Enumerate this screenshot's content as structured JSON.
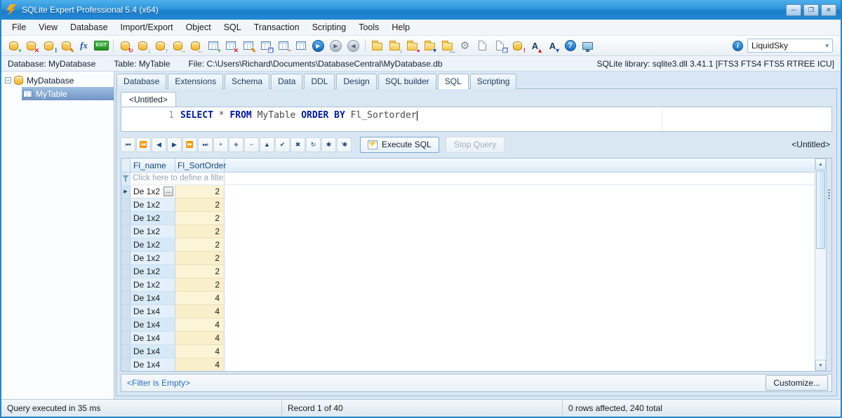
{
  "window": {
    "title": "SQLite Expert Professional 5.4 (x64)",
    "minimize_glyph": "─",
    "maximize_glyph": "❐",
    "close_glyph": "✕"
  },
  "menu": {
    "items": [
      "File",
      "View",
      "Database",
      "Import/Export",
      "Object",
      "SQL",
      "Transaction",
      "Scripting",
      "Tools",
      "Help"
    ]
  },
  "toolbar": {
    "icons": [
      {
        "name": "new-database-icon",
        "type": "db",
        "badge": "+",
        "badge_color": "#1f9d1f"
      },
      {
        "name": "close-database-icon",
        "type": "db",
        "badge": "✕",
        "badge_color": "#cc2222"
      },
      {
        "name": "rename-database-icon",
        "type": "db",
        "badge": "I",
        "badge_color": "#2255cc"
      },
      {
        "name": "edit-database-icon",
        "type": "db",
        "badge": "✎",
        "badge_color": "#d07a00"
      },
      {
        "name": "function-editor-icon",
        "type": "fx",
        "glyph": "fx"
      },
      {
        "name": "exit-icon",
        "type": "exit",
        "glyph": "EXIT"
      },
      {
        "type": "sep"
      },
      {
        "name": "reload-database-icon",
        "type": "db",
        "badge": "↻",
        "badge_color": "#cc2222"
      },
      {
        "name": "import-database-icon",
        "type": "db",
        "badge": "↓",
        "badge_color": "#1f9d1f"
      },
      {
        "name": "export-database-icon",
        "type": "db",
        "badge": "↑",
        "badge_color": "#2255cc"
      },
      {
        "name": "attach-database-icon",
        "type": "db",
        "badge": "→",
        "badge_color": "#1f9d1f"
      },
      {
        "name": "detach-database-icon",
        "type": "db",
        "badge": "←",
        "badge_color": "#cc2222"
      },
      {
        "name": "new-table-icon",
        "type": "table",
        "badge": "+",
        "badge_color": "#1f9d1f"
      },
      {
        "name": "drop-table-icon",
        "type": "table",
        "badge": "✕",
        "badge_color": "#cc2222"
      },
      {
        "name": "design-table-icon",
        "type": "table",
        "badge": "✎",
        "badge_color": "#d07a00"
      },
      {
        "name": "duplicate-table-icon",
        "type": "table",
        "badge": "❐",
        "badge_color": "#2255cc"
      },
      {
        "name": "empty-table-icon",
        "type": "table",
        "badge": "−",
        "badge_color": "#cc2222"
      },
      {
        "name": "view-data-icon",
        "type": "table"
      },
      {
        "name": "run-script-icon",
        "type": "circle-blue",
        "glyph": "▶"
      },
      {
        "name": "step-forward-icon",
        "type": "circle-gray",
        "glyph": "▶"
      },
      {
        "name": "step-back-icon",
        "type": "circle-gray",
        "glyph": "◀"
      },
      {
        "type": "sep"
      },
      {
        "name": "new-script-folder-icon",
        "type": "folder"
      },
      {
        "name": "open-script-icon",
        "type": "folder",
        "badge": "↓",
        "badge_color": "#2255cc"
      },
      {
        "name": "favorite-scripts-icon",
        "type": "folder",
        "badge": "●",
        "badge_color": "#d03a8a"
      },
      {
        "name": "save-script-icon",
        "type": "folder",
        "badge": "▼",
        "badge_color": "#2255cc"
      },
      {
        "name": "browse-scripts-icon",
        "type": "folder",
        "badge": "…",
        "badge_color": "#555555"
      },
      {
        "name": "options-gear-icon",
        "type": "gear",
        "glyph": "⚙"
      },
      {
        "name": "new-document-icon",
        "type": "doc"
      },
      {
        "name": "copy-document-icon",
        "type": "doc",
        "badge": "❐",
        "badge_color": "#2255cc"
      },
      {
        "name": "database-tools-icon",
        "type": "db",
        "badge": "!",
        "badge_color": "#cc2222"
      },
      {
        "name": "increase-font-icon",
        "type": "fontA",
        "glyph": "A",
        "badge": "▲",
        "badge_color": "#cc2222"
      },
      {
        "name": "decrease-font-icon",
        "type": "fontA",
        "glyph": "A",
        "badge": "▼",
        "badge_color": "#2255cc"
      },
      {
        "name": "help-icon",
        "type": "help",
        "glyph": "?"
      },
      {
        "name": "sql-monitor-icon",
        "type": "monitor"
      }
    ],
    "info_glyph": "i",
    "theme": {
      "selected": "LiquidSky",
      "dropdown_glyph": "▾"
    }
  },
  "info_bar": {
    "database": "Database: MyDatabase",
    "table": "Table: MyTable",
    "file": "File: C:\\Users\\Richard\\Documents\\DatabaseCentral\\MyDatabase.db",
    "library": "SQLite library: sqlite3.dll 3.41.1 [FTS3 FTS4 FTS5 RTREE ICU]"
  },
  "tree": {
    "expander_glyph": "−",
    "root": "MyDatabase",
    "child": "MyTable"
  },
  "tabs": {
    "items": [
      "Database",
      "Extensions",
      "Schema",
      "Data",
      "DDL",
      "Design",
      "SQL builder",
      "SQL",
      "Scripting"
    ],
    "active": "SQL"
  },
  "editor": {
    "tab": "<Untitled>",
    "line_number": "1",
    "tokens": [
      {
        "t": "SELECT ",
        "k": true
      },
      {
        "t": "* ",
        "k": false
      },
      {
        "t": "FROM ",
        "k": true
      },
      {
        "t": "MyTable ",
        "k": false
      },
      {
        "t": "ORDER BY ",
        "k": true
      },
      {
        "t": "Fl_Sortorder",
        "k": false
      }
    ]
  },
  "navigator": {
    "buttons": [
      {
        "name": "first",
        "g": "⏮"
      },
      {
        "name": "prior-page",
        "g": "⏪"
      },
      {
        "name": "prior",
        "g": "◀"
      },
      {
        "name": "next",
        "g": "▶"
      },
      {
        "name": "next-page",
        "g": "⏩"
      },
      {
        "name": "last",
        "g": "⏭"
      },
      {
        "name": "insert",
        "g": "+"
      },
      {
        "name": "append",
        "g": "⧺"
      },
      {
        "name": "delete",
        "g": "−"
      },
      {
        "name": "edit",
        "g": "▲"
      },
      {
        "name": "post",
        "g": "✔"
      },
      {
        "name": "cancel",
        "g": "✖"
      },
      {
        "name": "refresh",
        "g": "↻"
      },
      {
        "name": "set-bookmark",
        "g": "✱"
      },
      {
        "name": "goto-bookmark",
        "g": "'✱"
      }
    ],
    "execute_label": "Execute SQL",
    "execute_bolt": "⚡",
    "stop_label": "Stop Query",
    "result_tab": "<Untitled>"
  },
  "grid": {
    "columns": [
      "Fl_name",
      "Fl_SortOrder"
    ],
    "filter_placeholder": "Click here to define a filter",
    "row_marker": "▶",
    "ellipsis_button": "…",
    "selected_row": 0,
    "rows": [
      {
        "name": "De 1x2",
        "sort": "2"
      },
      {
        "name": "De 1x2",
        "sort": "2"
      },
      {
        "name": "De 1x2",
        "sort": "2"
      },
      {
        "name": "De 1x2",
        "sort": "2"
      },
      {
        "name": "De 1x2",
        "sort": "2"
      },
      {
        "name": "De 1x2",
        "sort": "2"
      },
      {
        "name": "De 1x2",
        "sort": "2"
      },
      {
        "name": "De 1x2",
        "sort": "2"
      },
      {
        "name": "De 1x4",
        "sort": "4"
      },
      {
        "name": "De 1x4",
        "sort": "4"
      },
      {
        "name": "De 1x4",
        "sort": "4"
      },
      {
        "name": "De 1x4",
        "sort": "4"
      },
      {
        "name": "De 1x4",
        "sort": "4"
      },
      {
        "name": "De 1x4",
        "sort": "4"
      }
    ],
    "scroll_up_glyph": "▲",
    "scroll_down_glyph": "▼",
    "filter_status": "<Filter is Empty>",
    "customize_label": "Customize..."
  },
  "status_bar": {
    "query": "Query executed in 35 ms",
    "record": "Record 1 of 40",
    "rows_affected": "0 rows affected, 240 total"
  }
}
